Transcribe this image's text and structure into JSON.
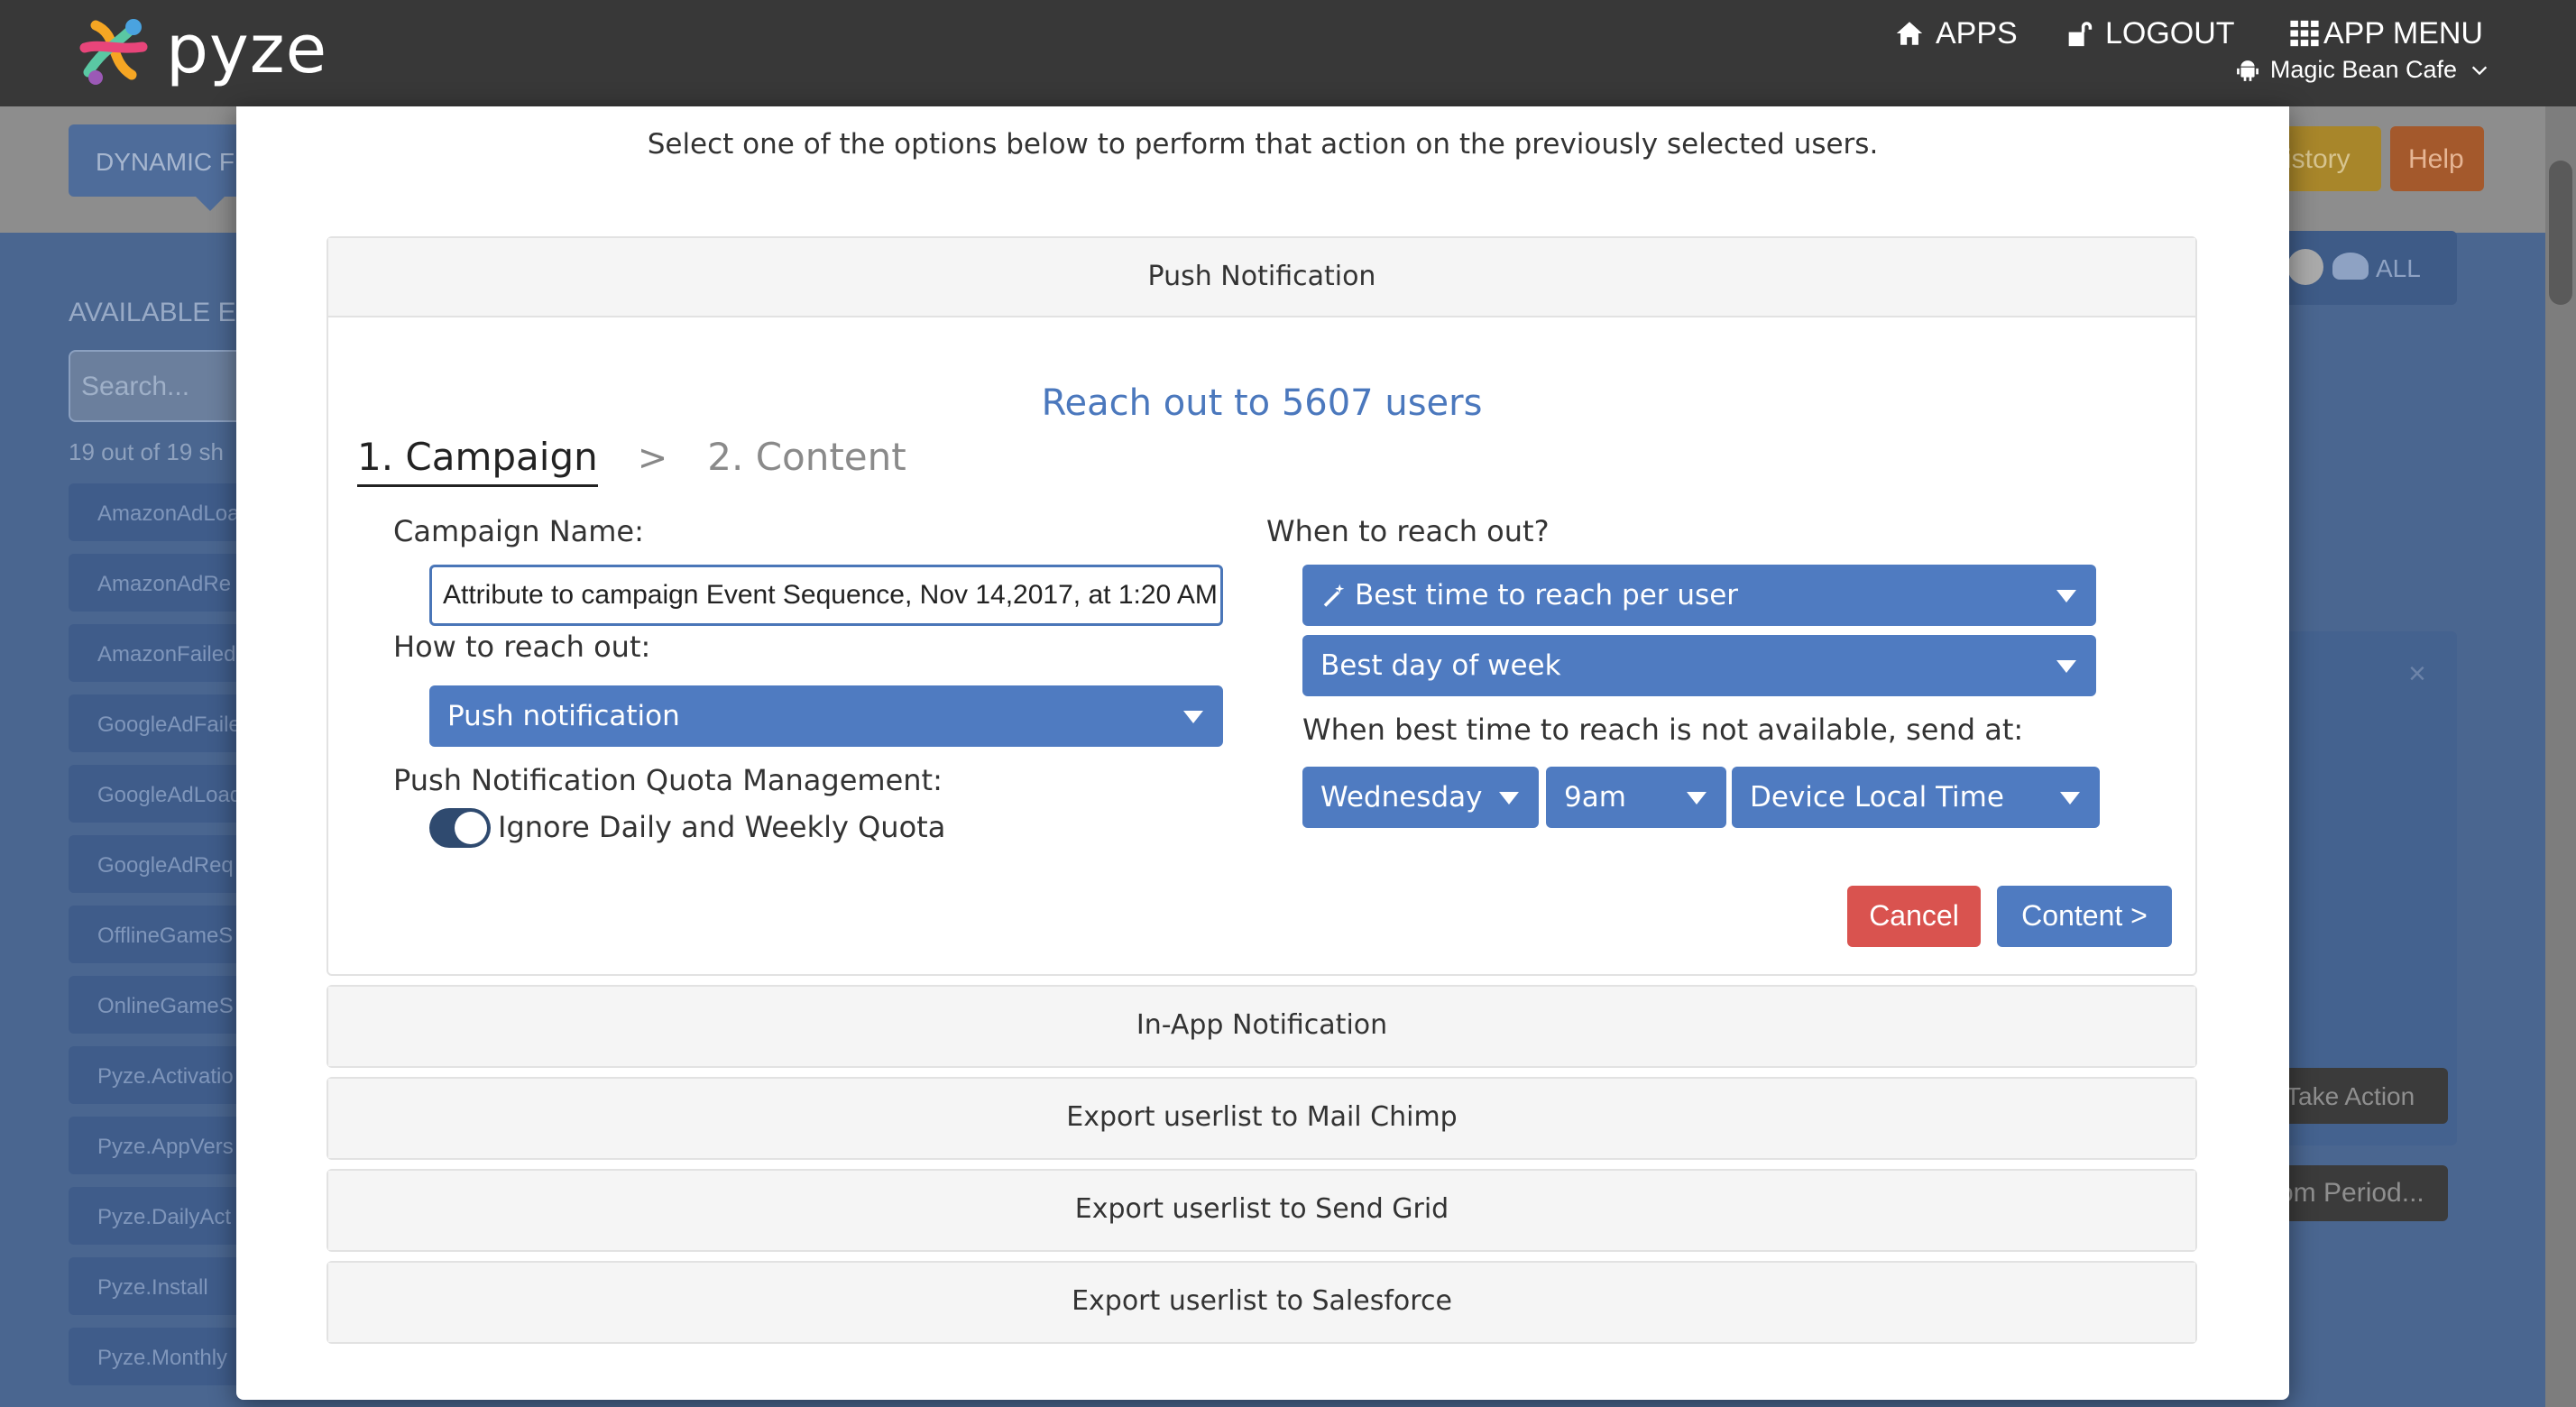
{
  "topbar": {
    "logo_text": "pyze",
    "apps_label": "APPS",
    "logout_label": "LOGOUT",
    "app_menu_label": "APP MENU",
    "selected_app": "Magic Bean Cafe"
  },
  "background": {
    "tab_label": "DYNAMIC FI",
    "history_label": "istory",
    "help_label": "Help",
    "all_label": "ALL",
    "available_label": "AVAILABLE E",
    "search_placeholder": "Search...",
    "count_text": "19 out of 19 sh",
    "items": [
      "AmazonAdLoa",
      "AmazonAdRe",
      "AmazonFailed",
      "GoogleAdFaile",
      "GoogleAdLoad",
      "GoogleAdReq",
      "OfflineGameS",
      "OnlineGameS",
      "Pyze.Activatio",
      "Pyze.AppVers",
      "Pyze.DailyAct",
      "Pyze.Install",
      "Pyze.Monthly"
    ],
    "take_action_label": "Take Action",
    "period_label": "om Period..."
  },
  "modal": {
    "intro": "Select one of the options below to perform that action on the previously selected users.",
    "push": {
      "header": "Push Notification",
      "reach_text": "Reach out to 5607 users",
      "step1": "1. Campaign",
      "step_sep": ">",
      "step2": "2. Content",
      "campaign_name_label": "Campaign Name:",
      "campaign_name_value": "Attribute to campaign Event Sequence, Nov 14,2017, at 1:20 AM",
      "how_label": "How to reach out:",
      "how_value": "Push notification",
      "quota_label": "Push Notification Quota Management:",
      "quota_toggle_label": "Ignore Daily and Weekly Quota",
      "quota_toggle_on": true,
      "when_label": "When to reach out?",
      "best_time_value": "Best time to reach per user",
      "best_day_value": "Best day of week",
      "fallback_label": "When best time to reach is not available, send at:",
      "fallback_day": "Wednesday",
      "fallback_time": "9am",
      "fallback_tz": "Device Local Time",
      "cancel_label": "Cancel",
      "content_label": "Content >"
    },
    "sections": [
      "In-App Notification",
      "Export userlist to Mail Chimp",
      "Export userlist to Send Grid",
      "Export userlist to Salesforce"
    ]
  },
  "colors": {
    "accent_blue": "#4f7bc1",
    "cancel_red": "#d9534f",
    "topbar": "#383838"
  }
}
